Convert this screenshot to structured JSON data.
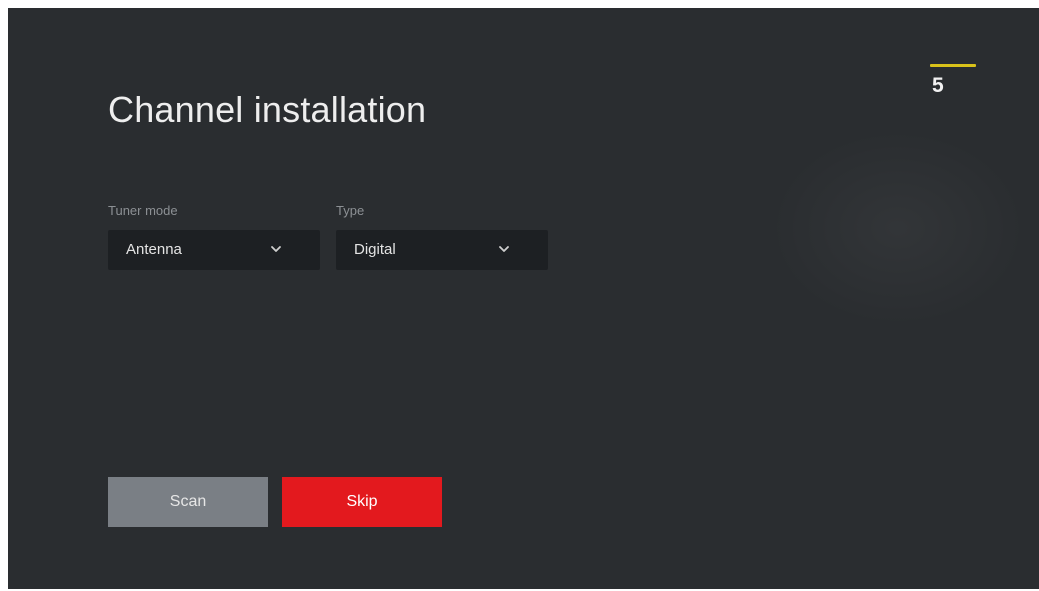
{
  "header": {
    "title": "Channel installation",
    "step_number": "5"
  },
  "form": {
    "tuner_mode": {
      "label": "Tuner mode",
      "value": "Antenna",
      "icon": "chevron-down-icon"
    },
    "type": {
      "label": "Type",
      "value": "Digital",
      "icon": "chevron-down-icon"
    }
  },
  "actions": {
    "scan_label": "Scan",
    "skip_label": "Skip"
  },
  "colors": {
    "background": "#2a2d30",
    "accent_red": "#e3191e",
    "step_bar": "#d9c21a",
    "scan_button": "#7a7f85",
    "select_background": "#1d2023"
  }
}
